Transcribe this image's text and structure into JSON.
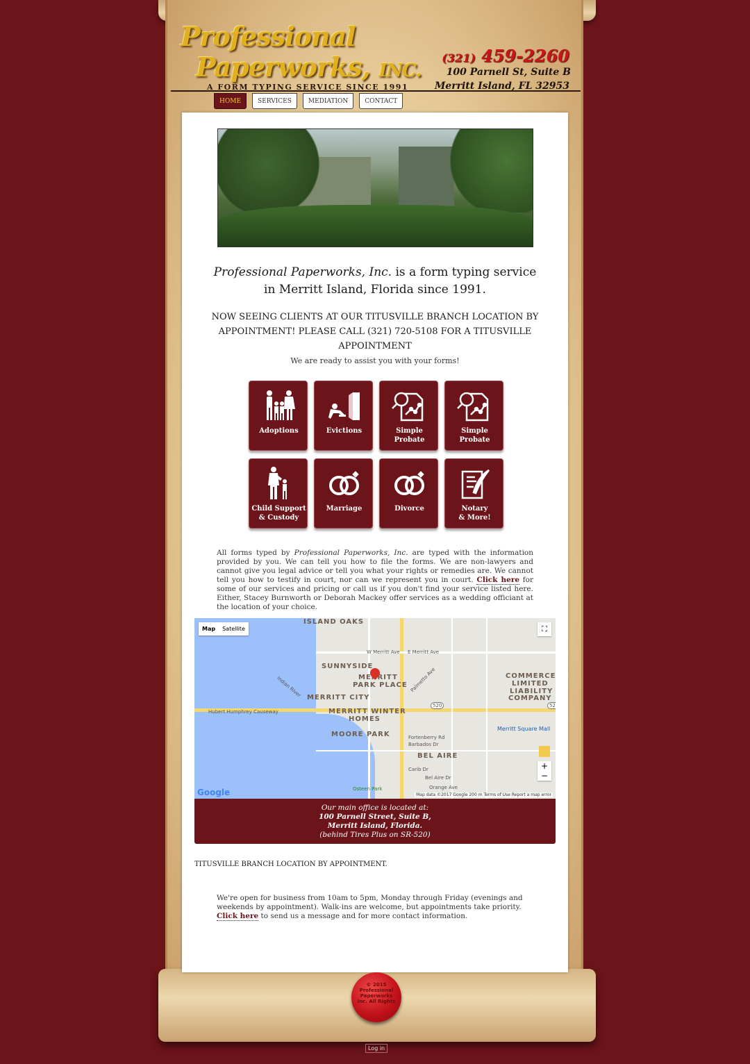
{
  "header": {
    "logo_line1": "Professional",
    "logo_line2": "Paperworks,",
    "logo_inc": "INC.",
    "tagline": "A FORM TYPING SERVICE SINCE 1991",
    "phone_area": "(321)",
    "phone_number": "459-2260",
    "address_line1": "100 Parnell St, Suite B",
    "address_line2": "Merritt Island, FL 32953"
  },
  "nav": {
    "items": [
      {
        "label": "HOME",
        "active": true
      },
      {
        "label": "SERVICES",
        "active": false
      },
      {
        "label": "MEDIATION",
        "active": false
      },
      {
        "label": "CONTACT",
        "active": false
      }
    ]
  },
  "intro": {
    "company": "Professional Paperworks, Inc.",
    "text1": " is a form typing service",
    "text2": "in Merritt Island, Florida since 1991."
  },
  "notice": "NOW SEEING CLIENTS AT OUR TITUSVILLE BRANCH LOCATION BY APPOINTMENT! PLEASE CALL (321) 720-5108 FOR A TITUSVILLE APPOINTMENT",
  "ready": "We are ready to assist you with your forms!",
  "tiles": [
    {
      "line1": "Adoptions",
      "line2": "",
      "icon": "family-icon"
    },
    {
      "line1": "Evictions",
      "line2": "",
      "icon": "eviction-icon"
    },
    {
      "line1": "Simple Probate",
      "line2": "",
      "icon": "magnifier-document-icon"
    },
    {
      "line1": "Simple Probate",
      "line2": "",
      "icon": "magnifier-document-icon"
    },
    {
      "line1": "Child Support",
      "line2": "& Custody",
      "icon": "parent-child-icon"
    },
    {
      "line1": "Marriage",
      "line2": "",
      "icon": "rings-icon"
    },
    {
      "line1": "Divorce",
      "line2": "",
      "icon": "rings-icon"
    },
    {
      "line1": "Notary",
      "line2": "& More!",
      "icon": "document-quill-icon"
    }
  ],
  "disclaimer": {
    "p1": "All forms typed by ",
    "company": "Professional Paperworks, Inc.",
    "p2": " are typed with the information provided by you. We can tell you how to file the forms. We are non-lawyers and cannot give you legal advice or tell you what your rights or remedies are. We cannot tell you how to testify in court, nor can we represent you in court. ",
    "link": "Click here",
    "p3": " for some of our services and pricing or call us if you don't find your service listed here. Either, Stacey Burnworth or Deborah Mackey offer services as a wedding officiant at the location of your choice."
  },
  "map": {
    "btn_map": "Map",
    "btn_satellite": "Satellite",
    "labels": {
      "island_oaks": "ISLAND OAKS",
      "sunnyside": "SUNNYSIDE",
      "merritt": "MERRITT",
      "park_place": "PARK PLACE",
      "merritt_city": "MERRITT CITY",
      "merritt_winter": "MERRITT WINTER",
      "homes": "HOMES",
      "moore_park": "MOORE PARK",
      "bel_aire": "BEL AIRE",
      "commerce": "COMMERCE",
      "limited": "LIMITED",
      "liability": "LIABILITY",
      "company": "COMPANY",
      "causeway": "Hubert Humphrey Causeway",
      "indian_river": "Indian River",
      "w_merritt_ave": "W Merritt Ave",
      "e_merritt_ave": "E Merritt Ave",
      "mall": "Merritt Square Mall",
      "osteen_park": "Osteen Park",
      "palmetto": "Palmetto Ave",
      "fortenberry": "Fortenberry Rd",
      "barbados": "Barbados Dr",
      "carib": "Carib Dr",
      "bel_aire_dr": "Bel Aire Dr",
      "orange_ave": "Orange Ave",
      "route_520": "520"
    },
    "google": "Google",
    "attribution": "Map data ©2017 Google   200 m   Terms of Use   Report a map error"
  },
  "office": {
    "line1": "Our main office is located at:",
    "line2": "100 Parnell Street, Suite B,",
    "line3": "Merritt Island, Florida.",
    "line4": "(behind Tires Plus on SR-520)"
  },
  "titusville": "TITUSVILLE BRANCH LOCATION BY APPOINTMENT.",
  "hours": {
    "p1": "We're open for business from 10am to 5pm, Monday through Friday (evenings and weekends by appointment). Walk-ins are welcome, but appointments take priority. ",
    "link": "Click here",
    "p2": " to send us a message and for more contact information."
  },
  "seal": {
    "line1": "© 2015",
    "line2": "Professional",
    "line3": "Paperworks",
    "line4": "Inc. All Rights"
  },
  "login": "Log in",
  "colors": {
    "brand": "#6b1419",
    "gold": "#e0b021",
    "phone": "#c8161b"
  }
}
